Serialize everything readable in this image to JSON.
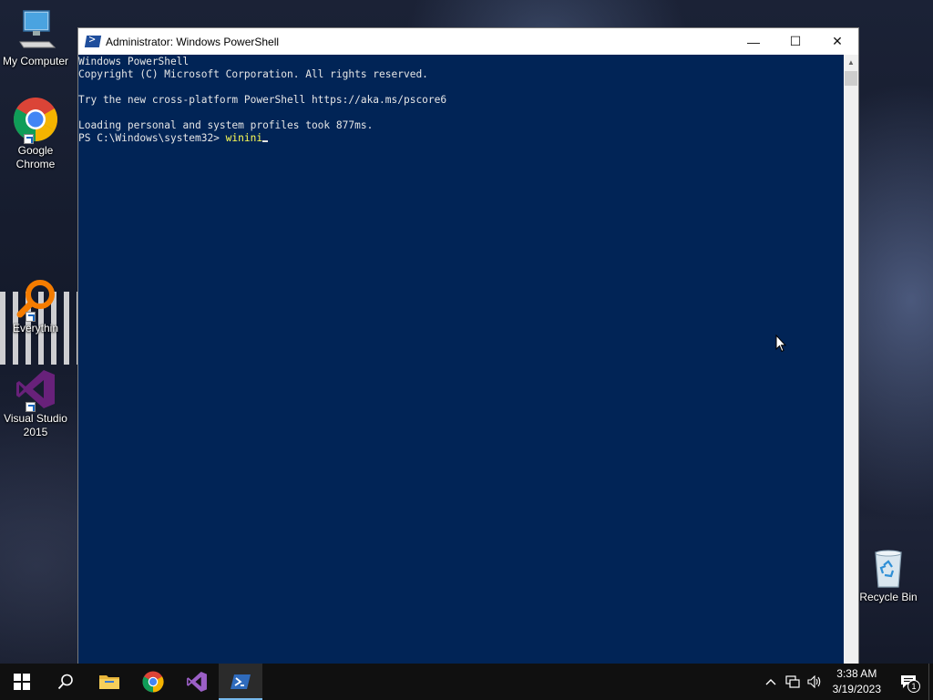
{
  "desktop": {
    "icons": [
      {
        "label": "My Computer"
      },
      {
        "label": "Google\nChrome"
      },
      {
        "label": "Everythin"
      },
      {
        "label": "Visual Studio\n2015"
      },
      {
        "label": "Recycle Bin"
      }
    ]
  },
  "window": {
    "title": "Administrator: Windows PowerShell",
    "controls": {
      "minimize": "—",
      "maximize": "☐",
      "close": "✕"
    },
    "console": {
      "lines": [
        "Windows PowerShell",
        "Copyright (C) Microsoft Corporation. All rights reserved.",
        "",
        "Try the new cross-platform PowerShell https://aka.ms/pscore6",
        "",
        "Loading personal and system profiles took 877ms."
      ],
      "prompt": "PS C:\\Windows\\system32> ",
      "command": "winini"
    }
  },
  "taskbar": {
    "apps": [
      {
        "name": "start",
        "icon": "windows-logo"
      },
      {
        "name": "search",
        "icon": "search-icon"
      },
      {
        "name": "file-explorer",
        "icon": "folder-icon"
      },
      {
        "name": "google-chrome",
        "icon": "chrome-icon"
      },
      {
        "name": "visual-studio",
        "icon": "visual-studio-icon"
      },
      {
        "name": "powershell",
        "icon": "powershell-icon",
        "active": true
      }
    ],
    "clock": {
      "time": "3:38 AM",
      "date": "3/19/2023"
    },
    "notification_count": "1"
  },
  "colors": {
    "console_bg": "#012456",
    "console_fg": "#e6e6e6",
    "command_fg": "#ffff54",
    "taskbar_bg": "#101010",
    "active_accent": "#76b9ed"
  }
}
